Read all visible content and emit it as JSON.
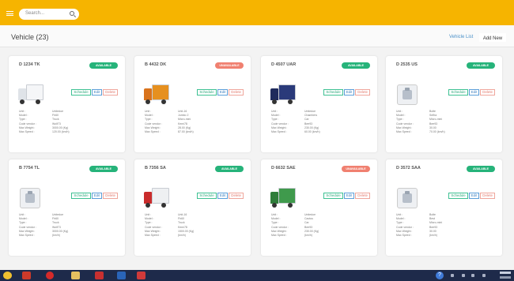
{
  "search": {
    "placeholder": "Search..."
  },
  "header": {
    "title": "Vehicle (23)",
    "vehicle_list": "Vehicle List",
    "add_new": "Add New"
  },
  "labels": {
    "unit": "Unit :",
    "model": "Model :",
    "type": "Type :",
    "code_vendor": "Code vendor :",
    "max_weight": "Max Weight :",
    "max_speed": "Max Speed :",
    "schedule": "Schedule",
    "edit": "Edit",
    "delete": "Delete"
  },
  "colors": {
    "topbar": "#f6b400",
    "available": "#26b37a",
    "unavailable": "#f08070",
    "schedule": "#3ec193",
    "edit": "#5c9fd9",
    "delete": "#efa69c"
  },
  "vehicles": [
    {
      "plate": "D 1234 TK",
      "status": "AVAILABLE",
      "image": "white-truck-icon",
      "unit": "Unitedoe",
      "model": "Fh60",
      "type": "Truck",
      "code_vendor": "Wolf73",
      "max_weight": "3000.00 (Kg)",
      "max_speed": "120.00 (km/h)"
    },
    {
      "plate": "B 4432 DK",
      "status": "UNAVAILABLE",
      "image": "orange-dump-truck-icon",
      "unit": "Unit-16",
      "model": "Jumbo 2",
      "type": "Micro-mini",
      "code_vendor": "Kemi78",
      "max_weight": "28.00 (Kg)",
      "max_speed": "87.00 (km/h)"
    },
    {
      "plate": "D 4507 UAR",
      "status": "AVAILABLE",
      "image": "navy-box-truck-icon",
      "unit": "Unitedoe",
      "model": "Chambers",
      "type": "Car",
      "code_vendor": "Bee93",
      "max_weight": "230.00 (Kg)",
      "max_speed": "60.00 (km/h)"
    },
    {
      "plate": "D 2535 US",
      "status": "AVAILABLE",
      "image": "engine-part-icon",
      "unit": "Bolte",
      "model": "Selfra",
      "type": "Micro-mini",
      "code_vendor": "Bee93",
      "max_weight": "30.00",
      "max_speed": "70.00 (km/h)"
    },
    {
      "plate": "B 7754 TL",
      "status": "AVAILABLE",
      "image": "engine-part-icon",
      "unit": "Unitedoe",
      "model": "Fh60",
      "type": "Truck",
      "code_vendor": "Wolf73",
      "max_weight": "3000.00 (Kg)",
      "max_speed": "(km/h)"
    },
    {
      "plate": "B 7356 SA",
      "status": "AVAILABLE",
      "image": "red-white-truck-icon",
      "unit": "Unit-16",
      "model": "Fh60",
      "type": "Truck",
      "code_vendor": "Kemi78",
      "max_weight": "1500.00 (Kg)",
      "max_speed": "(km/h)"
    },
    {
      "plate": "D 6632 SAE",
      "status": "UNAVAILABLE",
      "image": "green-box-truck-icon",
      "unit": "Unitedoe",
      "model": "Cactus",
      "type": "Car",
      "code_vendor": "Bee93",
      "max_weight": "230.00 (Kg)",
      "max_speed": "(km/h)"
    },
    {
      "plate": "D 3572 SAA",
      "status": "AVAILABLE",
      "image": "engine-part-icon",
      "unit": "Bolte",
      "model": "Best",
      "type": "Micro-mini",
      "code_vendor": "Bee93",
      "max_weight": "30.00",
      "max_speed": "(km/h)"
    }
  ],
  "taskbar": {
    "help": "?"
  }
}
